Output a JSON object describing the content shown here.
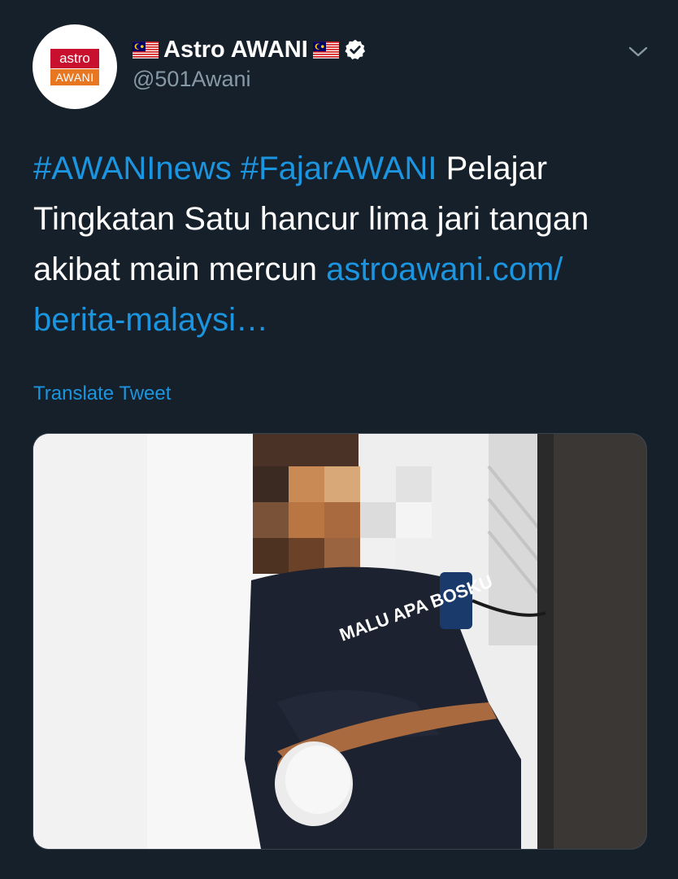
{
  "author": {
    "display_name": "Astro AWANI",
    "handle": "@501Awani",
    "verified": true,
    "avatar_logo": {
      "line1": "astro",
      "line2": "AWANI"
    }
  },
  "icons": {
    "flag": "malaysia-flag-icon",
    "verified": "verified-badge-icon",
    "menu": "chevron-down-icon"
  },
  "tweet": {
    "hashtag1": "#AWANInews",
    "hashtag2": "#FajarAWANI",
    "text1": "Pelajar Tingkatan Satu hancur lima jari tangan akibat main mercun",
    "link": "astroawani.com/ berita-malaysi…"
  },
  "translate_label": "Translate Tweet",
  "media": {
    "shirt_text": "MALU APA BOSKU"
  },
  "colors": {
    "background": "#15202b",
    "link": "#1b95e0",
    "secondary": "#8899a6",
    "verified": "#ffffff"
  }
}
